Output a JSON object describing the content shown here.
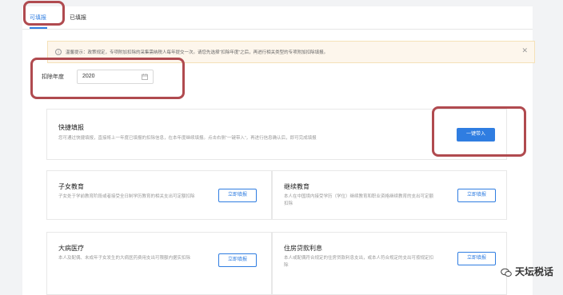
{
  "tabs": [
    {
      "label": "可填报"
    },
    {
      "label": "已填报"
    }
  ],
  "notice": {
    "text": "温馨提示：政策规定，专项附加扣除的采集需纳税人每年提交一次。请您先选择“扣除年度”之后，再进行相关类型的专项附加扣除填报。",
    "close": "✕"
  },
  "year": {
    "label": "扣除年度",
    "value": "2020"
  },
  "quick": {
    "title": "快捷填报",
    "desc": "您可通过快捷填报，直接将上一年度已填报的扣除信息，在本年度继续填报。点击右侧“一键带入”，再进行信息确认后，即可完成填报",
    "button": "一键带入"
  },
  "cards": [
    {
      "title": "子女教育",
      "desc": "子女处于学前教育阶段或者接受全日制学历教育的相关支出可定额扣除",
      "button": "立即填报"
    },
    {
      "title": "继续教育",
      "desc": "本人在中国境内接受学历（学位）继续教育和职业资格继续教育的支出可定额扣除",
      "button": "立即填报"
    },
    {
      "title": "大病医疗",
      "desc": "本人及配偶、未成年子女发生的大病医药费用支出可限额内据实扣除",
      "button": "立即填报"
    },
    {
      "title": "住房贷款利息",
      "desc": "本人或配偶符合规定的住房贷款利息支出，或本人符合规定的支出可按规定扣除",
      "button": "立即填报"
    }
  ],
  "watermark": {
    "text": "天坛税话"
  },
  "colors": {
    "accent": "#2f7de1",
    "highlight": "#b04a4f",
    "notice_bg": "#fdf6ec"
  }
}
